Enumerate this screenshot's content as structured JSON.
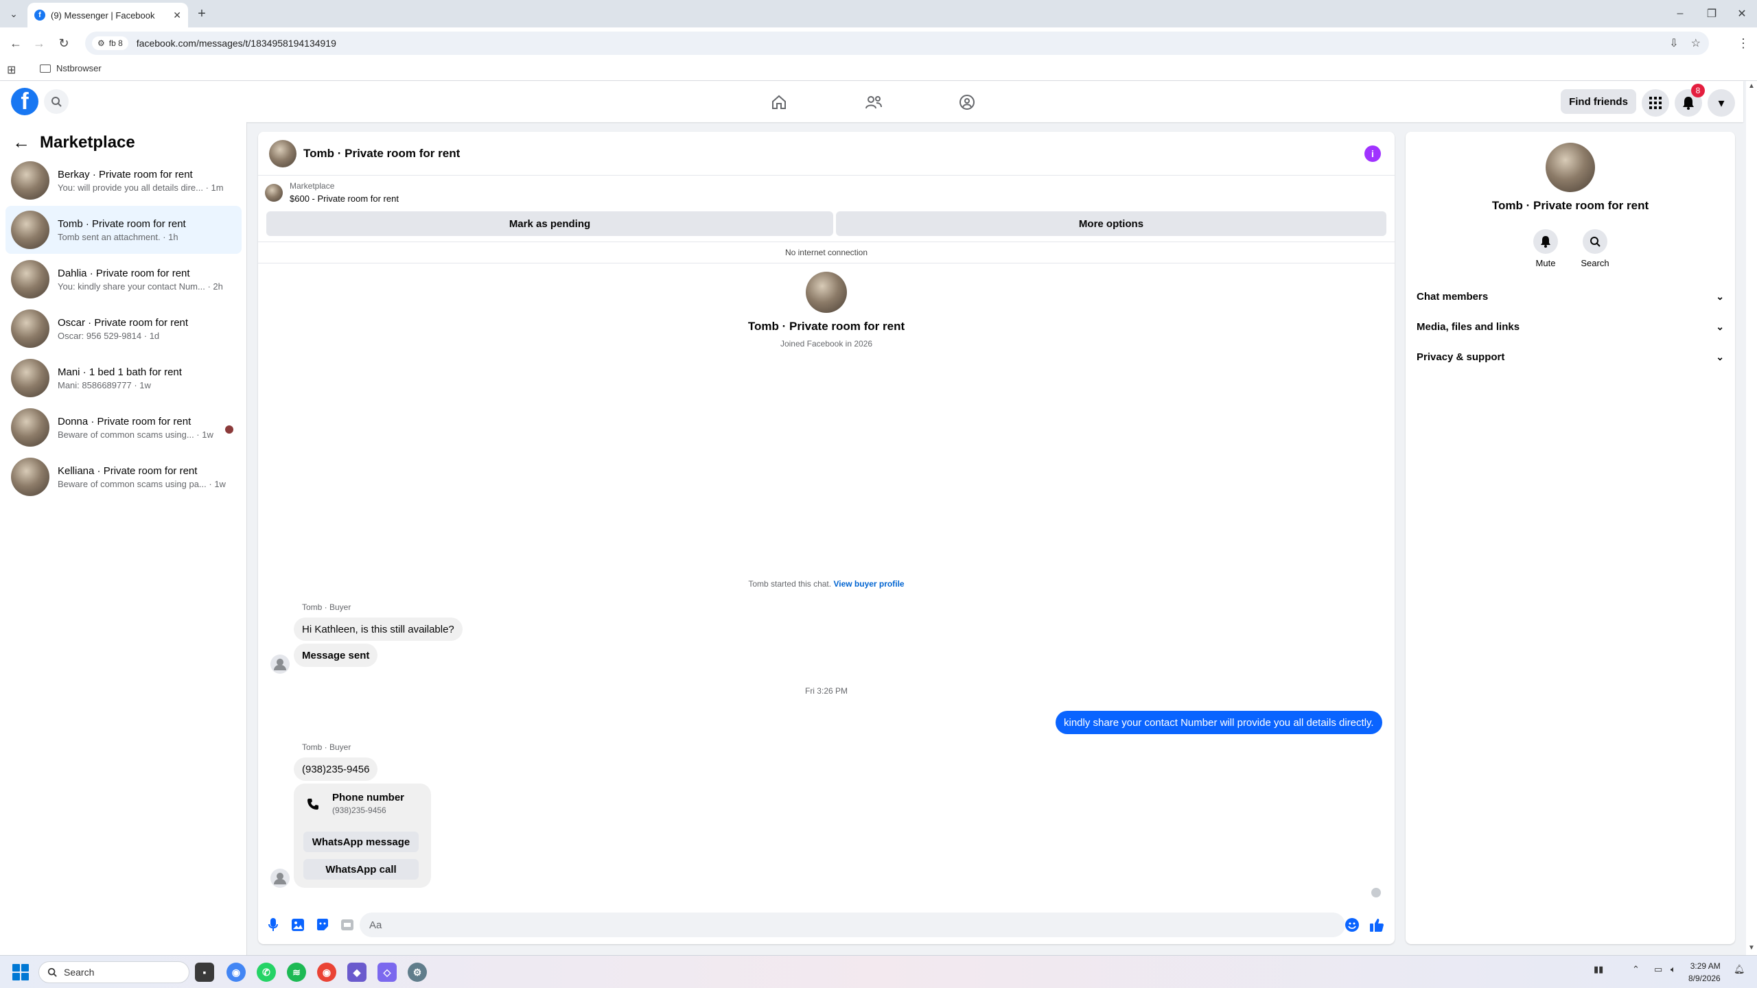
{
  "browser": {
    "tab_title": "(9) Messenger | Facebook",
    "url": "facebook.com/messages/t/1834958194134919",
    "site_chip": "fb 8",
    "bookmark_folder": "Nstbrowser"
  },
  "fb_header": {
    "find_friends": "Find friends",
    "notification_count": "8"
  },
  "sidebar": {
    "title": "Marketplace",
    "conversations": [
      {
        "name": "Berkay · Private room for rent",
        "preview": "You: will provide you all details dire... · 1m",
        "active": false
      },
      {
        "name": "Tomb · Private room for rent",
        "preview": "Tomb sent an attachment. · 1h",
        "active": true
      },
      {
        "name": "Dahlia · Private room for rent",
        "preview": "You: kindly share your contact Num... · 2h",
        "active": false
      },
      {
        "name": "Oscar · Private room for rent",
        "preview": "Oscar: 956 529-9814 · 1d",
        "active": false
      },
      {
        "name": "Mani · 1 bed 1 bath for rent",
        "preview": "Mani: 8586689777 · 1w",
        "active": false
      },
      {
        "name": "Donna · Private room for rent",
        "preview": "Beware of common scams using... · 1w",
        "active": false
      },
      {
        "name": "Kelliana · Private room for rent",
        "preview": "Beware of common scams using pa... · 1w",
        "active": false
      }
    ]
  },
  "chat": {
    "title": "Tomb · Private room for rent",
    "marketplace_label": "Marketplace",
    "listing": "$600 - Private room for rent",
    "mark_pending": "Mark as pending",
    "more_options": "More options",
    "network_status": "No internet connection",
    "profile_name": "Tomb · Private room for rent",
    "profile_joined": "Joined Facebook in 2026",
    "started_text": "Tomb started this chat.",
    "view_profile": "View buyer profile",
    "sender_label": "Tomb · Buyer",
    "msg1": "Hi Kathleen, is this still available?",
    "msg2": "Message sent",
    "timestamp": "Fri 3:26 PM",
    "my_msg": "kindly share your contact Number will provide you all details directly.",
    "sender_label2": "Tomb · Buyer",
    "msg3": "(938)235-9456",
    "phone_card_title": "Phone number",
    "phone_card_number": "(938)235-9456",
    "whatsapp_message": "WhatsApp message",
    "whatsapp_call": "WhatsApp call",
    "input_placeholder": "Aa"
  },
  "info_panel": {
    "name": "Tomb · Private room for rent",
    "mute": "Mute",
    "search": "Search",
    "sections": [
      "Chat members",
      "Media, files and links",
      "Privacy & support"
    ]
  },
  "taskbar": {
    "search_placeholder": "Search",
    "time": "3:29 AM",
    "date": "8/9/2026"
  },
  "colors": {
    "fb_blue": "#1877f2",
    "my_bubble": "#0a64ff",
    "active_conv": "#ebf5ff",
    "info_purple": "#a033ff"
  }
}
